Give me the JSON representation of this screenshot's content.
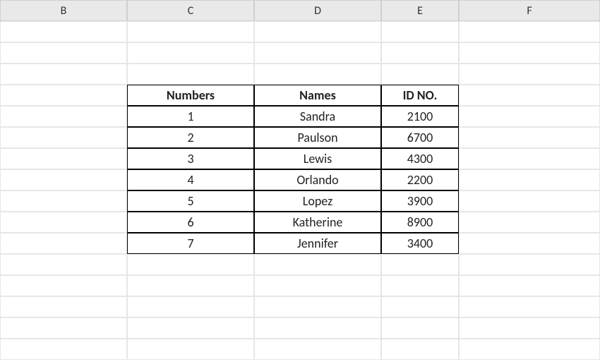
{
  "columns": {
    "b": "B",
    "c": "C",
    "d": "D",
    "e": "E",
    "f": "F"
  },
  "table": {
    "headers": {
      "numbers": "Numbers",
      "names": "Names",
      "id_no": "ID NO."
    },
    "rows": [
      {
        "number": "1",
        "name": "Sandra",
        "id": "2100"
      },
      {
        "number": "2",
        "name": "Paulson",
        "id": "6700"
      },
      {
        "number": "3",
        "name": "Lewis",
        "id": "4300"
      },
      {
        "number": "4",
        "name": "Orlando",
        "id": "2200"
      },
      {
        "number": "5",
        "name": "Lopez",
        "id": "3900"
      },
      {
        "number": "6",
        "name": "Katherine",
        "id": "8900"
      },
      {
        "number": "7",
        "name": "Jennifer",
        "id": "3400"
      }
    ]
  }
}
